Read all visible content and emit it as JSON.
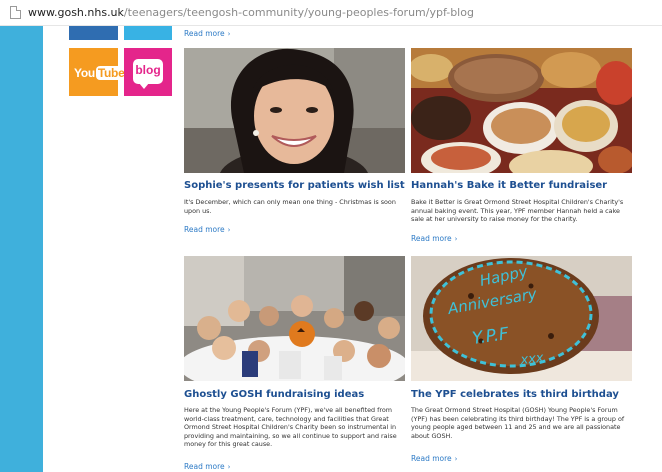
{
  "browser": {
    "url_host": "www.gosh.nhs.uk",
    "url_path": "/teenagers/teengosh-community/young-peoples-forum/ypf-blog"
  },
  "social": {
    "youtube_you": "You",
    "youtube_tube": "Tube",
    "blog_label": "blog"
  },
  "top_read_more": "Read more",
  "read_more_arrow": "›",
  "posts": [
    {
      "title": "Sophie's presents for patients wish list",
      "text": "It's December, which can only mean one thing - Christmas is soon upon us.",
      "read_more": "Read more"
    },
    {
      "title": "Hannah's Bake it Better fundraiser",
      "text": "Bake it Better is Great Ormond Street Hospital Children's Charity's annual baking event. This year, YPF member Hannah held a cake sale at her university to raise money for the charity.",
      "read_more": "Read more"
    },
    {
      "title": "Ghostly GOSH fundraising ideas",
      "text": "Here at the Young People's Forum (YPF), we've all benefited from world-class treatment, care, technology and facilities that Great Ormond Street Hospital Children's Charity been so instrumental in providing and maintaining, so we all continue to support and raise money for this great cause.",
      "read_more": "Read more"
    },
    {
      "title": "The YPF celebrates its third birthday",
      "text": "The Great Ormond Street Hospital (GOSH) Young People's Forum (YPF) has been celebrating its third birthday! The YPF is a group of young people aged between 11 and 25 and we are all passionate about GOSH.",
      "read_more": "Read more"
    }
  ],
  "cookie_text": {
    "line1": "Happy",
    "line2": "Anniversary",
    "line3": "Y.P.F",
    "line4": "xxx"
  },
  "colors": {
    "sidebar_blue": "#3fb0dc",
    "title_blue": "#1d4f91",
    "link_blue": "#2e7bc6",
    "youtube_orange": "#f59b20",
    "blog_pink": "#e4258b"
  }
}
